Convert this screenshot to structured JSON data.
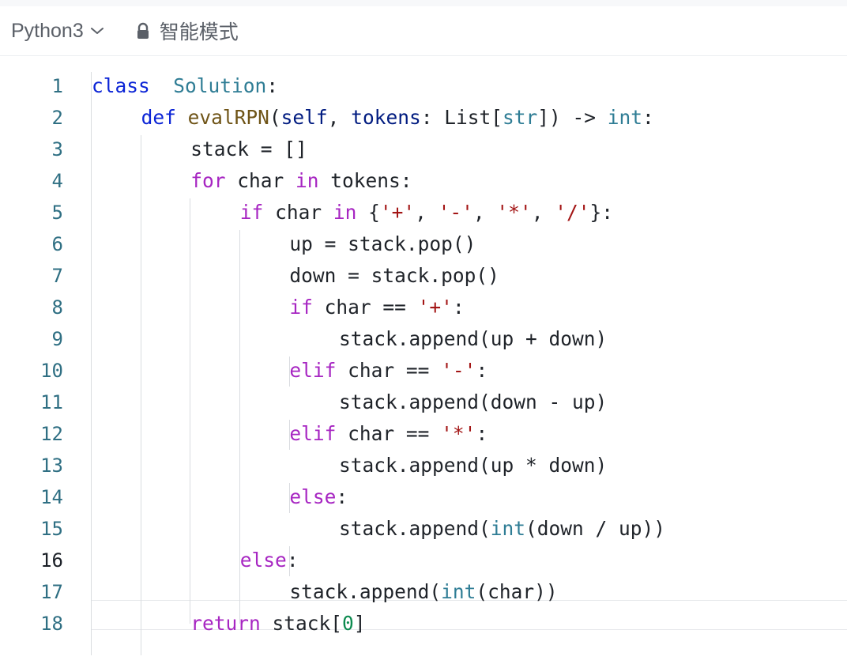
{
  "toolbar": {
    "language": "Python3",
    "mode_label": "智能模式",
    "icons": {
      "dropdown": "chevron-down-icon",
      "lock": "lock-icon"
    }
  },
  "editor": {
    "active_line": 16,
    "lines": [
      {
        "n": "1",
        "indent": 0,
        "tokens": [
          [
            "kw",
            "class"
          ],
          [
            "",
            "  "
          ],
          [
            "cls",
            "Solution"
          ],
          [
            "",
            ":"
          ]
        ]
      },
      {
        "n": "2",
        "indent": 1,
        "tokens": [
          [
            "kw",
            "def"
          ],
          [
            "",
            " "
          ],
          [
            "fn",
            "evalRPN"
          ],
          [
            "",
            "("
          ],
          [
            "param",
            "self"
          ],
          [
            "",
            ", "
          ],
          [
            "param",
            "tokens"
          ],
          [
            "",
            ": List["
          ],
          [
            "bi",
            "str"
          ],
          [
            "",
            "]) -> "
          ],
          [
            "bi",
            "int"
          ],
          [
            "",
            ":"
          ]
        ]
      },
      {
        "n": "3",
        "indent": 2,
        "tokens": [
          [
            "",
            "stack = []"
          ]
        ]
      },
      {
        "n": "4",
        "indent": 2,
        "tokens": [
          [
            "kw2",
            "for"
          ],
          [
            "",
            " char "
          ],
          [
            "kw2",
            "in"
          ],
          [
            "",
            " tokens:"
          ]
        ]
      },
      {
        "n": "5",
        "indent": 3,
        "tokens": [
          [
            "kw2",
            "if"
          ],
          [
            "",
            " char "
          ],
          [
            "kw2",
            "in"
          ],
          [
            "",
            " {"
          ],
          [
            "str",
            "'+'"
          ],
          [
            "",
            ", "
          ],
          [
            "str",
            "'-'"
          ],
          [
            "",
            ", "
          ],
          [
            "str",
            "'*'"
          ],
          [
            "",
            ", "
          ],
          [
            "str",
            "'/'"
          ],
          [
            "",
            "}:"
          ]
        ]
      },
      {
        "n": "6",
        "indent": 4,
        "tokens": [
          [
            "",
            "up = stack.pop()"
          ]
        ]
      },
      {
        "n": "7",
        "indent": 4,
        "tokens": [
          [
            "",
            "down = stack.pop()"
          ]
        ]
      },
      {
        "n": "8",
        "indent": 4,
        "tokens": [
          [
            "kw2",
            "if"
          ],
          [
            "",
            " char == "
          ],
          [
            "str",
            "'+'"
          ],
          [
            "",
            ":"
          ]
        ]
      },
      {
        "n": "9",
        "indent": 5,
        "tokens": [
          [
            "",
            "stack.append(up + down)"
          ]
        ]
      },
      {
        "n": "10",
        "indent": 4,
        "tokens": [
          [
            "kw2",
            "elif"
          ],
          [
            "",
            " char == "
          ],
          [
            "str",
            "'-'"
          ],
          [
            "",
            ":"
          ]
        ]
      },
      {
        "n": "11",
        "indent": 5,
        "tokens": [
          [
            "",
            "stack.append(down - up)"
          ]
        ]
      },
      {
        "n": "12",
        "indent": 4,
        "tokens": [
          [
            "kw2",
            "elif"
          ],
          [
            "",
            " char == "
          ],
          [
            "str",
            "'*'"
          ],
          [
            "",
            ":"
          ]
        ]
      },
      {
        "n": "13",
        "indent": 5,
        "tokens": [
          [
            "",
            "stack.append(up * down)"
          ]
        ]
      },
      {
        "n": "14",
        "indent": 4,
        "tokens": [
          [
            "kw2",
            "else"
          ],
          [
            "",
            ":"
          ]
        ]
      },
      {
        "n": "15",
        "indent": 5,
        "tokens": [
          [
            "",
            "stack.append("
          ],
          [
            "bi",
            "int"
          ],
          [
            "",
            "(down / up))"
          ]
        ]
      },
      {
        "n": "16",
        "indent": 3,
        "tokens": [
          [
            "kw2",
            "else"
          ],
          [
            "",
            ":"
          ]
        ]
      },
      {
        "n": "17",
        "indent": 4,
        "tokens": [
          [
            "",
            "stack.append("
          ],
          [
            "bi",
            "int"
          ],
          [
            "",
            "(char))"
          ]
        ]
      },
      {
        "n": "18",
        "indent": 2,
        "tokens": [
          [
            "kw2",
            "return"
          ],
          [
            "",
            " stack["
          ],
          [
            "num",
            "0"
          ],
          [
            "",
            "]"
          ]
        ]
      }
    ]
  }
}
